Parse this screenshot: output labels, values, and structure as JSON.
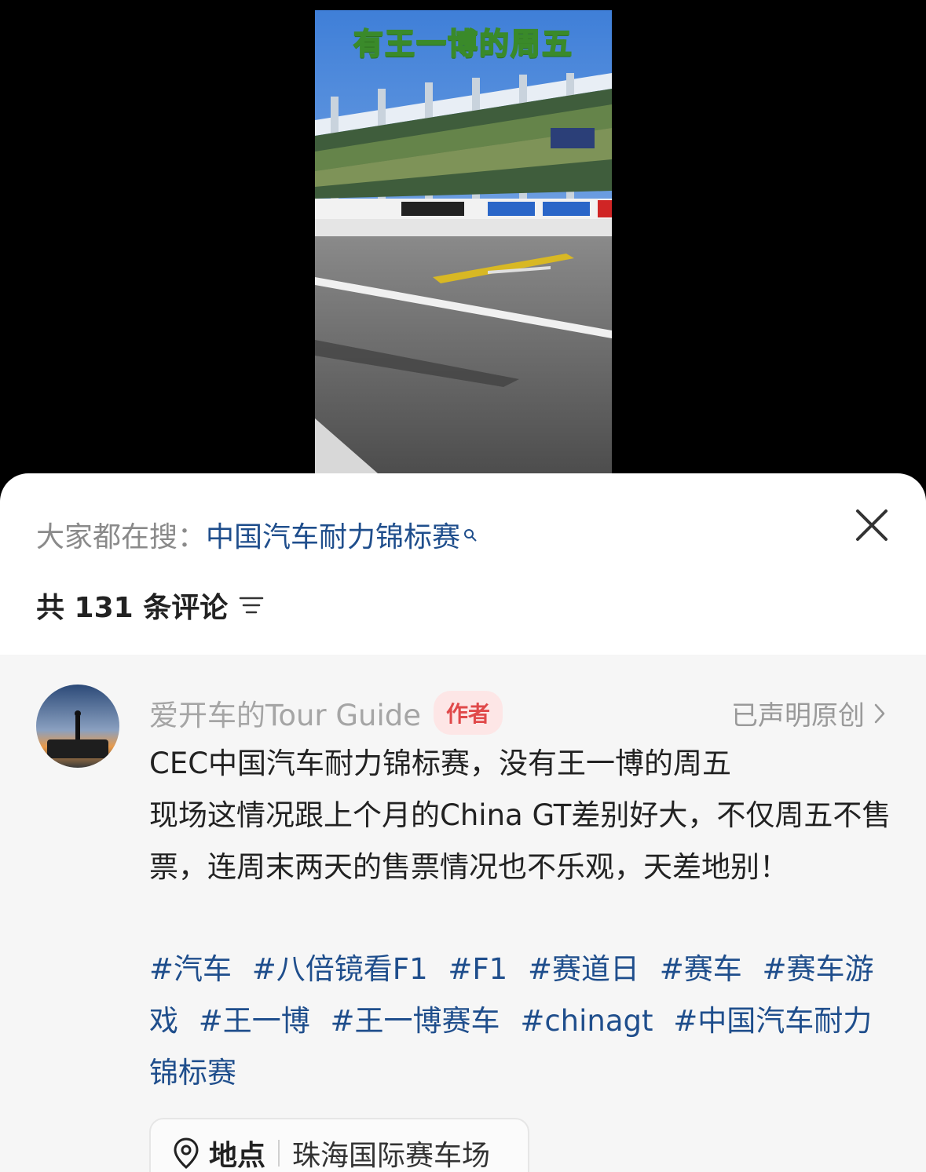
{
  "video": {
    "caption": "有王一博的周五"
  },
  "search": {
    "prefix": "大家都在搜：",
    "term": "中国汽车耐力锦标赛"
  },
  "comments": {
    "count_label": "共 131 条评论"
  },
  "post": {
    "author": "爱开车的Tour Guide",
    "author_badge": "作者",
    "original_label": "已声明原创",
    "body_lines": [
      "CEC中国汽车耐力锦标赛，没有王一博的周五",
      "现场这情况跟上个月的China GT差别好大，不仅周五不售票，连周末两天的售票情况也不乐观，天差地别！"
    ],
    "tags": [
      "#汽车",
      "#八倍镜看F1",
      "#F1",
      "#赛道日",
      "#赛车",
      "#赛车游戏",
      "#王一博",
      "#王一博赛车",
      "#chinagt",
      "#中国汽车耐力锦标赛"
    ],
    "location_label": "地点",
    "location_value": "珠海国际赛车场"
  },
  "colors": {
    "link": "#1f4e8c",
    "badge_text": "#e0494a",
    "badge_bg": "#fde6e6"
  },
  "icons": [
    "search-icon",
    "close-icon",
    "sort-icon",
    "chevron-right-icon",
    "location-pin-icon"
  ]
}
